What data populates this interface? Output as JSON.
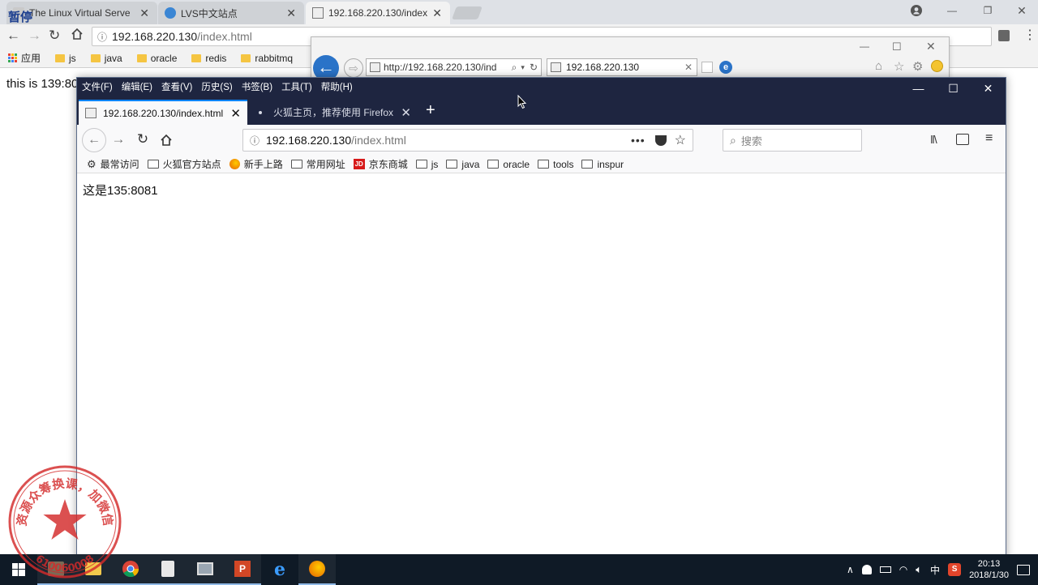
{
  "pause_label": "暂停",
  "chrome": {
    "tabs": [
      {
        "title": "The Linux Virtual Serve",
        "close": "✕"
      },
      {
        "title": "LVS中文站点",
        "close": "✕"
      },
      {
        "title": "192.168.220.130/index",
        "close": "✕"
      }
    ],
    "url_host": "192.168.220.130",
    "url_path": "/index.html",
    "apps_label": "应用",
    "bookmarks": [
      "js",
      "java",
      "oracle",
      "redis",
      "rabbitmq"
    ],
    "page_text": "this is 139:8080"
  },
  "ie": {
    "address": "http://192.168.220.130/ind",
    "tab_title": "192.168.220.130"
  },
  "firefox": {
    "menu": [
      "文件(F)",
      "编辑(E)",
      "查看(V)",
      "历史(S)",
      "书签(B)",
      "工具(T)",
      "帮助(H)"
    ],
    "tabs": [
      {
        "title": "192.168.220.130/index.html"
      },
      {
        "title": "火狐主页，推荐使用 Firefox 火"
      }
    ],
    "url_host": "192.168.220.130",
    "url_path": "/index.html",
    "search_placeholder": "搜索",
    "bookmarks": [
      {
        "label": "最常访问",
        "icon": "gear-icon"
      },
      {
        "label": "火狐官方站点",
        "icon": "folder-icon"
      },
      {
        "label": "新手上路",
        "icon": "firefox-icon"
      },
      {
        "label": "常用网址",
        "icon": "folder-icon"
      },
      {
        "label": "京东商城",
        "icon": "jd-icon"
      },
      {
        "label": "js",
        "icon": "folder-icon"
      },
      {
        "label": "java",
        "icon": "folder-icon"
      },
      {
        "label": "oracle",
        "icon": "folder-icon"
      },
      {
        "label": "tools",
        "icon": "folder-icon"
      },
      {
        "label": "inspur",
        "icon": "folder-icon"
      }
    ],
    "page_text": "这是135:8081"
  },
  "taskbar": {
    "ime": "中",
    "time": "20:13",
    "date": "2018/1/30"
  },
  "stamp": {
    "text": "资源众筹换课，加微信",
    "number": "610060008"
  },
  "colors": {
    "ff_titlebar": "#1e2540",
    "ff_accent": "#0a84ff",
    "ie_accent": "#2a73c8",
    "stamp_red": "#d42a2a",
    "taskbar": "#0f1a26"
  }
}
